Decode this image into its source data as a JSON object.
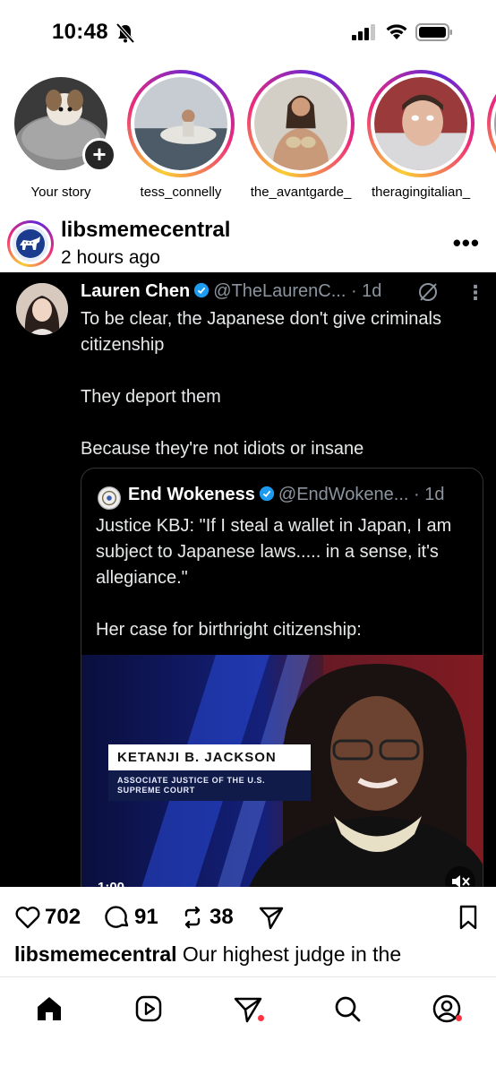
{
  "status_bar": {
    "time": "10:48"
  },
  "stories": [
    {
      "label": "Your story"
    },
    {
      "label": "tess_connelly"
    },
    {
      "label": "the_avantgarde_"
    },
    {
      "label": "theragingitalian_"
    }
  ],
  "post": {
    "username": "libsmemecentral",
    "time": "2 hours ago"
  },
  "tweet": {
    "name": "Lauren Chen",
    "handle": "@TheLaurenC...",
    "age": "· 1d",
    "lines": [
      "To be clear, the Japanese don't give criminals citizenship",
      "They deport them",
      "Because they're not idiots or insane"
    ],
    "quote": {
      "name": "End Wokeness",
      "handle": "@EndWokene...",
      "age": "· 1d",
      "line1": "Justice KBJ: \"If I steal a wallet in Japan, I am subject to Japanese laws..... in a sense, it's allegiance.\"",
      "line2": "Her case for birthright citizenship:",
      "video": {
        "lower_third_name": "KETANJI B. JACKSON",
        "lower_third_title": "ASSOCIATE JUSTICE OF THE U.S. SUPREME COURT",
        "duration": "1:00"
      }
    }
  },
  "actions": {
    "likes": "702",
    "comments": "91",
    "reposts": "38"
  },
  "caption": {
    "username": "libsmemecentral",
    "text": "Our highest judge in the"
  },
  "colors": {
    "notification_dot": "#ff3040",
    "verified": "#1d9bf0"
  }
}
